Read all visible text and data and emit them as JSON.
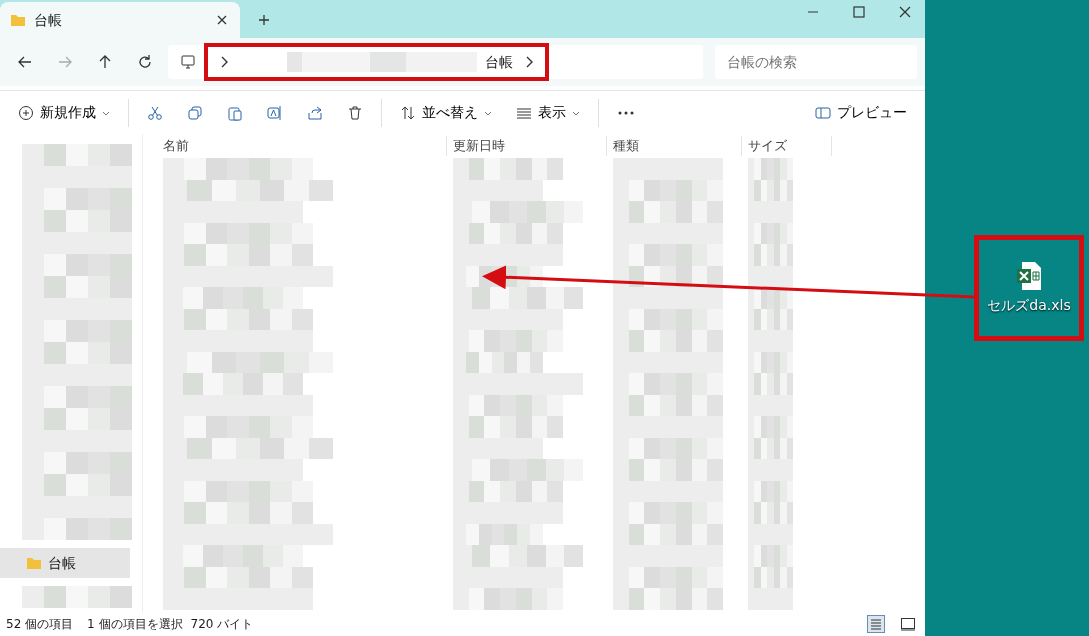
{
  "window": {
    "tab": {
      "title": "台帳"
    }
  },
  "address_bar": {
    "folder": "台帳",
    "highlighted": true
  },
  "search": {
    "placeholder": "台帳の検索"
  },
  "toolbar": {
    "new": "新規作成",
    "sort": "並べ替え",
    "view": "表示",
    "preview": "プレビュー"
  },
  "columns": [
    "名前",
    "更新日時",
    "種類",
    "サイズ"
  ],
  "sidebar": {
    "items": [
      {
        "label": "台帳",
        "selected": true
      }
    ]
  },
  "status_bar": {
    "count": "52 個の項目",
    "selection": "1 個の項目を選択",
    "size": "720 バイト"
  },
  "desktop": {
    "file": {
      "label": "セルズda.xls",
      "highlighted": true
    }
  }
}
